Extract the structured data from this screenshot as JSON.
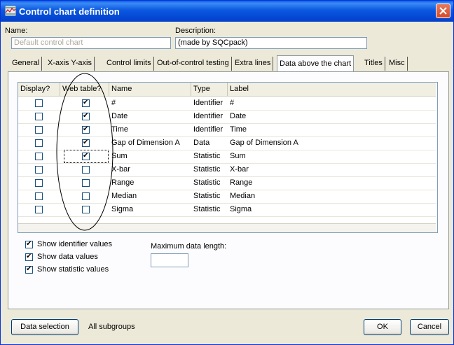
{
  "window": {
    "title": "Control chart definition"
  },
  "name": {
    "label": "Name:",
    "value": "Default control chart"
  },
  "description": {
    "label": "Description:",
    "value": "(made by SQCpack)"
  },
  "tabs": [
    {
      "label": "General"
    },
    {
      "label": "X-axis Y-axis"
    },
    {
      "label": "Control limits"
    },
    {
      "label": "Out-of-control testing"
    },
    {
      "label": "Extra lines"
    },
    {
      "label": "Data above the chart",
      "active": true
    },
    {
      "label": "Titles"
    },
    {
      "label": "Misc"
    }
  ],
  "grid": {
    "headers": {
      "display": "Display?",
      "web": "Web table?",
      "name": "Name",
      "type": "Type",
      "label": "Label"
    },
    "rows": [
      {
        "display": false,
        "web": true,
        "name": "#",
        "type": "Identifier",
        "label": "#"
      },
      {
        "display": false,
        "web": true,
        "name": "Date",
        "type": "Identifier",
        "label": "Date"
      },
      {
        "display": false,
        "web": true,
        "name": "Time",
        "type": "Identifier",
        "label": "Time"
      },
      {
        "display": false,
        "web": true,
        "name": "Gap of Dimension A",
        "type": "Data",
        "label": "Gap of Dimension A"
      },
      {
        "display": false,
        "web": true,
        "name": "Sum",
        "type": "Statistic",
        "label": "Sum"
      },
      {
        "display": false,
        "web": false,
        "name": "X-bar",
        "type": "Statistic",
        "label": "X-bar"
      },
      {
        "display": false,
        "web": false,
        "name": "Range",
        "type": "Statistic",
        "label": "Range"
      },
      {
        "display": false,
        "web": false,
        "name": "Median",
        "type": "Statistic",
        "label": "Median"
      },
      {
        "display": false,
        "web": false,
        "name": "Sigma",
        "type": "Statistic",
        "label": "Sigma"
      }
    ]
  },
  "options": {
    "show_identifier": {
      "label": "Show identifier values",
      "checked": true
    },
    "show_data": {
      "label": "Show data values",
      "checked": true
    },
    "show_statistic": {
      "label": "Show statistic values",
      "checked": true
    }
  },
  "max_data_length": {
    "label": "Maximum data length:",
    "value": ""
  },
  "footer": {
    "data_selection": "Data selection",
    "subgroups": "All subgroups",
    "ok": "OK",
    "cancel": "Cancel"
  }
}
